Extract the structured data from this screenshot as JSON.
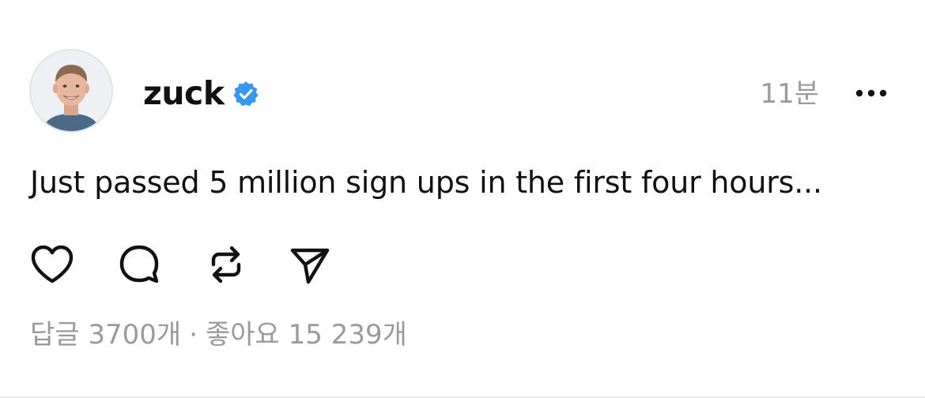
{
  "post": {
    "author": {
      "username": "zuck",
      "verified": true,
      "verified_color": "#3897f0"
    },
    "timestamp": "11분",
    "more_icon": "more-horizontal-icon",
    "text": "Just passed 5 million sign ups in the first four hours...",
    "actions": [
      {
        "name": "like",
        "icon": "heart-icon"
      },
      {
        "name": "reply",
        "icon": "comment-bubble-icon"
      },
      {
        "name": "repost",
        "icon": "repost-icon"
      },
      {
        "name": "share",
        "icon": "send-icon"
      }
    ],
    "stats": {
      "replies": "답글 3700개",
      "separator": "·",
      "likes": "좋아요 15 239개"
    }
  }
}
